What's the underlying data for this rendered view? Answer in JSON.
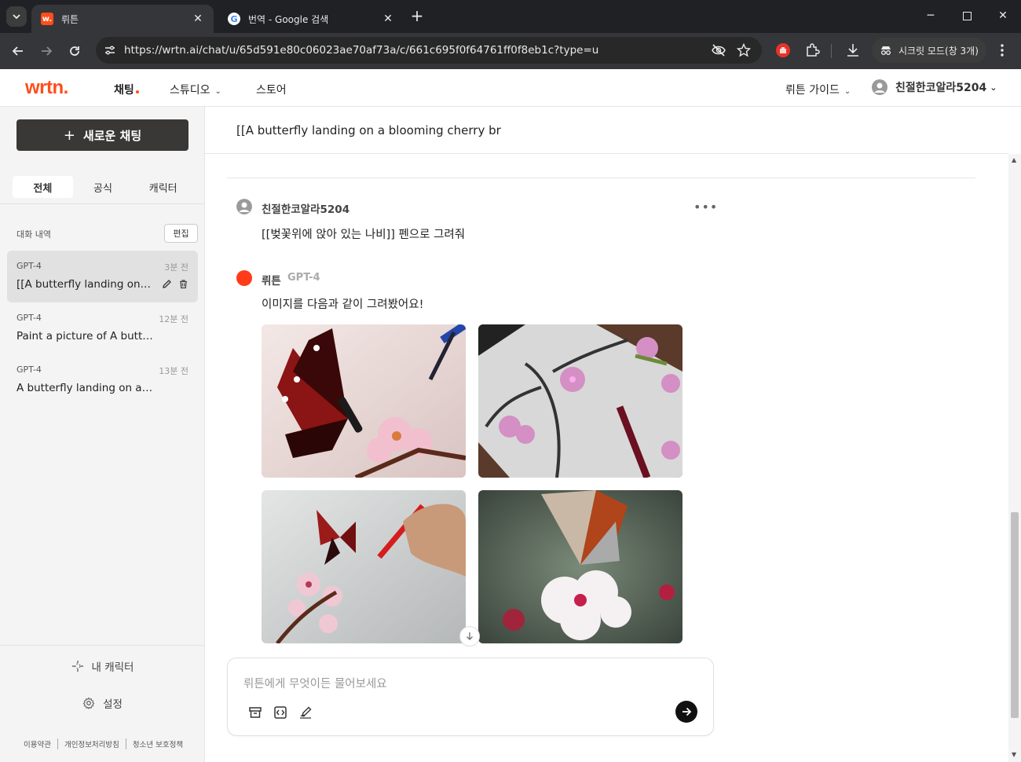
{
  "browser": {
    "tabs": [
      {
        "title": "뤼튼",
        "active": true
      },
      {
        "title": "번역 - Google 검색",
        "active": false
      }
    ],
    "url": "https://wrtn.ai/chat/u/65d591e80c06023ae70af73a/c/661c695f0f64761ff0f8eb1c?type=u",
    "incognito_label": "시크릿 모드(창 3개)"
  },
  "app": {
    "logo": "wrtn.",
    "nav": {
      "chat": "채팅",
      "studio": "스튜디오",
      "store": "스토어",
      "guide": "뤼튼 가이드",
      "user": "친절한코알라5204"
    },
    "accent": "#ff4d1c"
  },
  "sidebar": {
    "new_chat": "새로운 채팅",
    "filters": [
      "전체",
      "공식",
      "캐릭터"
    ],
    "history_label": "대화 내역",
    "edit": "편집",
    "history": [
      {
        "model": "GPT-4",
        "time": "3분 전",
        "title": "[[A butterfly landing on a ..."
      },
      {
        "model": "GPT-4",
        "time": "12분 전",
        "title": "Paint a picture of A butte..."
      },
      {
        "model": "GPT-4",
        "time": "13분 전",
        "title": "A butterfly landing on a b..."
      }
    ],
    "my_character": "내 캐릭터",
    "settings": "설정",
    "legal": [
      "이용약관",
      "개인정보처리방침",
      "청소년 보호정책"
    ]
  },
  "chat": {
    "title": "[[A butterfly landing on a blooming cherry br",
    "user_name": "친절한코알라5204",
    "user_message": "[[벚꽃위에 앉아 있는 나비]] 펜으로 그려줘",
    "bot_name": "뤼튼",
    "bot_model": "GPT-4",
    "bot_message": "이미지를 다음과 같이 그려봤어요!",
    "input_placeholder": "뤼튼에게 무엇이든 물어보세요"
  }
}
